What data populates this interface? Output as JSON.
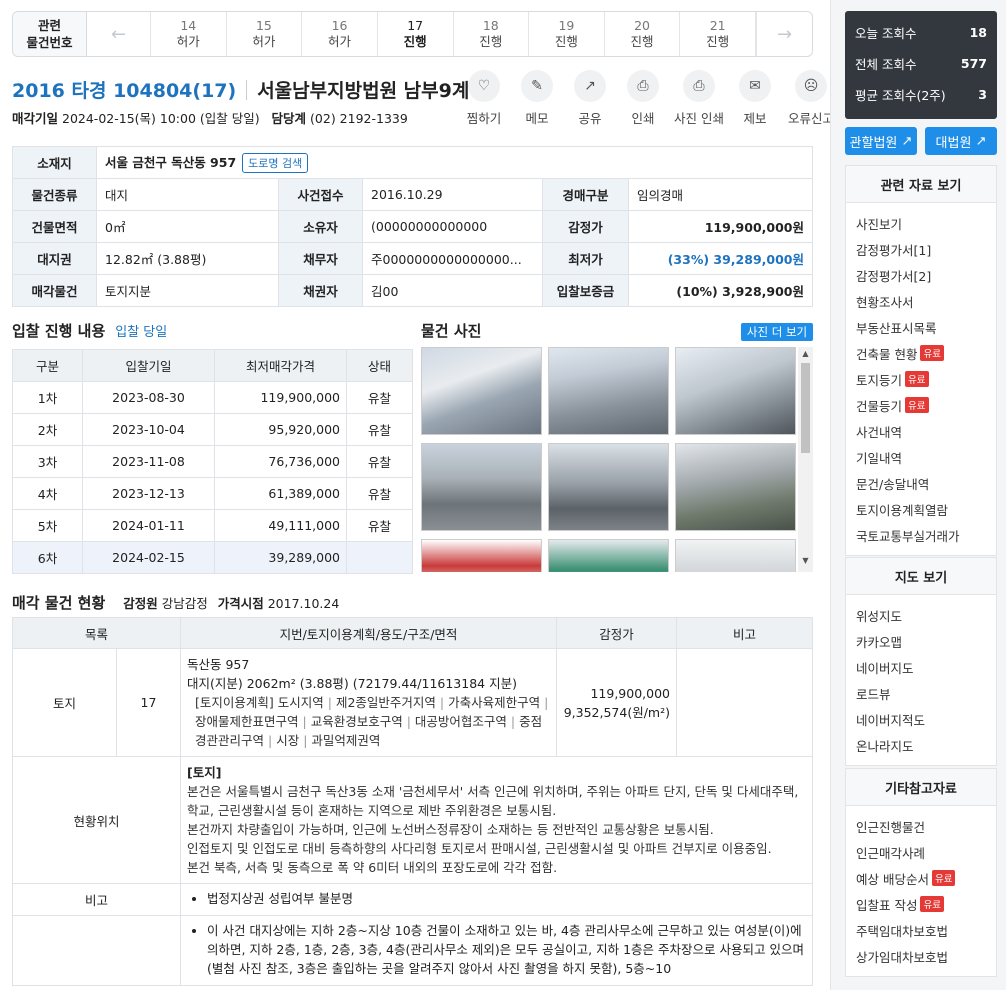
{
  "nav": {
    "label": [
      "관련",
      "물건번호"
    ],
    "items": [
      {
        "num": "14",
        "status": "허가"
      },
      {
        "num": "15",
        "status": "허가"
      },
      {
        "num": "16",
        "status": "허가"
      },
      {
        "num": "17",
        "status": "진행"
      },
      {
        "num": "18",
        "status": "진행"
      },
      {
        "num": "19",
        "status": "진행"
      },
      {
        "num": "20",
        "status": "진행"
      },
      {
        "num": "21",
        "status": "진행"
      }
    ]
  },
  "header": {
    "case_no": "2016 타경 104804(17)",
    "court": "서울남부지방법원 남부9계",
    "sale_date_label": "매각기일",
    "sale_date": "2024-02-15(목) 10:00 (입찰 당일)",
    "contact_label": "담당계",
    "contact": "(02) 2192-1339"
  },
  "actions": [
    {
      "icon": "heart-icon",
      "label": "찜하기"
    },
    {
      "icon": "memo-icon",
      "label": "메모"
    },
    {
      "icon": "share-icon",
      "label": "공유"
    },
    {
      "icon": "print-icon",
      "label": "인쇄"
    },
    {
      "icon": "photo-print-icon",
      "label": "사진 인쇄"
    },
    {
      "icon": "mail-icon",
      "label": "제보"
    },
    {
      "icon": "error-icon",
      "label": "오류신고"
    }
  ],
  "info": {
    "address_label": "소재지",
    "address": "서울 금천구 독산동 957",
    "road_search": "도로명 검색",
    "type_label": "물건종류",
    "type": "대지",
    "received_label": "사건접수",
    "received": "2016.10.29",
    "auction_label": "경매구분",
    "auction": "임의경매",
    "building_area_label": "건물면적",
    "building_area": "0㎡",
    "owner_label": "소유자",
    "owner": "(00000000000000",
    "appraisal_label": "감정가",
    "appraisal": "119,900,000원",
    "land_right_label": "대지권",
    "land_right": "12.82㎡ (3.88평)",
    "debtor_label": "채무자",
    "debtor": "주0000000000000000...",
    "min_price_label": "최저가",
    "min_price": "(33%) 39,289,000원",
    "sale_item_label": "매각물건",
    "sale_item": "토지지분",
    "creditor_label": "채권자",
    "creditor": "김00",
    "deposit_label": "입찰보증금",
    "deposit": "(10%) 3,928,900원"
  },
  "bid": {
    "title": "입찰 진행 내용",
    "subtitle": "입찰 당일",
    "headers": [
      "구분",
      "입찰기일",
      "최저매각가격",
      "상태"
    ],
    "rows": [
      {
        "round": "1차",
        "date": "2023-08-30",
        "price": "119,900,000",
        "status": "유찰"
      },
      {
        "round": "2차",
        "date": "2023-10-04",
        "price": "95,920,000",
        "status": "유찰"
      },
      {
        "round": "3차",
        "date": "2023-11-08",
        "price": "76,736,000",
        "status": "유찰"
      },
      {
        "round": "4차",
        "date": "2023-12-13",
        "price": "61,389,000",
        "status": "유찰"
      },
      {
        "round": "5차",
        "date": "2024-01-11",
        "price": "49,111,000",
        "status": "유찰"
      },
      {
        "round": "6차",
        "date": "2024-02-15",
        "price": "39,289,000",
        "status": ""
      }
    ]
  },
  "photos": {
    "title": "물건 사진",
    "more": "사진 더 보기"
  },
  "property": {
    "title": "매각 물건 현황",
    "appraiser_label": "감정원",
    "appraiser": "강남감정",
    "price_point_label": "가격시점",
    "price_point": "2017.10.24",
    "headers": [
      "목록",
      "지번/토지이용계획/용도/구조/면적",
      "감정가",
      "비고"
    ],
    "land_type": "토지",
    "land_no": "17",
    "land_addr": "독산동 957",
    "land_area": "대지(지분) 2062m² (3.88평) (72179.44/11613184 지분)",
    "land_plan_head": "[토지이용계획]",
    "land_plan": [
      "도시지역",
      "제2종일반주거지역",
      "가축사육제한구역",
      "장애물제한표면구역",
      "교육환경보호구역",
      "대공방어협조구역",
      "중점경관관리구역",
      "시장",
      "과밀억제권역"
    ],
    "land_price": "119,900,000",
    "land_unit_price": "9,352,574(원/m²)",
    "loc_label": "현황위치",
    "loc_head": "[토지]",
    "loc_text": "본건은 서울특별시 금천구 독산3동 소재 '금천세무서' 서측 인근에 위치하며, 주위는 아파트 단지, 단독 및 다세대주택, 학교, 근린생활시설 등이 혼재하는 지역으로 제반 주위환경은 보통시됨.",
    "loc_text2": "본건까지 차량출입이 가능하며, 인근에 노선버스정류장이 소재하는 등 전반적인 교통상황은 보통시됨.",
    "loc_text3": "인접토지 및 인접도로 대비 등측하향의 사다리형 토지로서 판매시설, 근린생활시설 및 아파트 건부지로 이용중임.",
    "loc_text4": "본건 북측, 서측 및 동측으로 폭 약 6미터 내외의 포장도로에 각각 접함.",
    "note_label": "비고",
    "note": "법정지상권 성립여부 불분명",
    "note2": "이 사건 대지상에는 지하 2층~지상 10층 건물이 소재하고 있는 바, 4층 관리사무소에 근무하고 있는 여성분(이)에 의하면, 지하 2층, 1층, 2층, 3층, 4층(관리사무소 제외)은 모두 공실이고, 지하 1층은 주차장으로 사용되고 있으며(별첨 사진 참조, 3층은 출입하는 곳을 알려주지 않아서 사진 촬영을 하지 못함), 5층~10"
  },
  "side": {
    "stats": [
      {
        "label": "오늘 조회수",
        "value": "18"
      },
      {
        "label": "전체 조회수",
        "value": "577"
      },
      {
        "label": "평균 조회수(2주)",
        "value": "3"
      }
    ],
    "court_btn": "관할법원",
    "supreme_btn": "대법원",
    "ref_title": "관련 자료 보기",
    "ref_items": [
      {
        "label": "사진보기",
        "paid": ""
      },
      {
        "label": "감정평가서[1]",
        "paid": ""
      },
      {
        "label": "감정평가서[2]",
        "paid": ""
      },
      {
        "label": "현황조사서",
        "paid": ""
      },
      {
        "label": "부동산표시목록",
        "paid": ""
      },
      {
        "label": "건축물 현황",
        "paid": "유료"
      },
      {
        "label": "토지등기",
        "paid": "유료"
      },
      {
        "label": "건물등기",
        "paid": "유료"
      },
      {
        "label": "사건내역",
        "paid": ""
      },
      {
        "label": "기일내역",
        "paid": ""
      },
      {
        "label": "문건/송달내역",
        "paid": ""
      },
      {
        "label": "토지이용계획열람",
        "paid": ""
      },
      {
        "label": "국토교통부실거래가",
        "paid": ""
      }
    ],
    "map_title": "지도 보기",
    "map_items": [
      "위성지도",
      "카카오맵",
      "네이버지도",
      "로드뷰",
      "네이버지적도",
      "온나라지도"
    ],
    "etc_title": "기타참고자료",
    "etc_items": [
      {
        "label": "인근진행물건",
        "paid": ""
      },
      {
        "label": "인근매각사례",
        "paid": ""
      },
      {
        "label": "예상 배당순서",
        "paid": "유료"
      },
      {
        "label": "입찰표 작성",
        "paid": "유료"
      },
      {
        "label": "주택임대차보호법",
        "paid": ""
      },
      {
        "label": "상가임대차보호법",
        "paid": ""
      }
    ]
  }
}
